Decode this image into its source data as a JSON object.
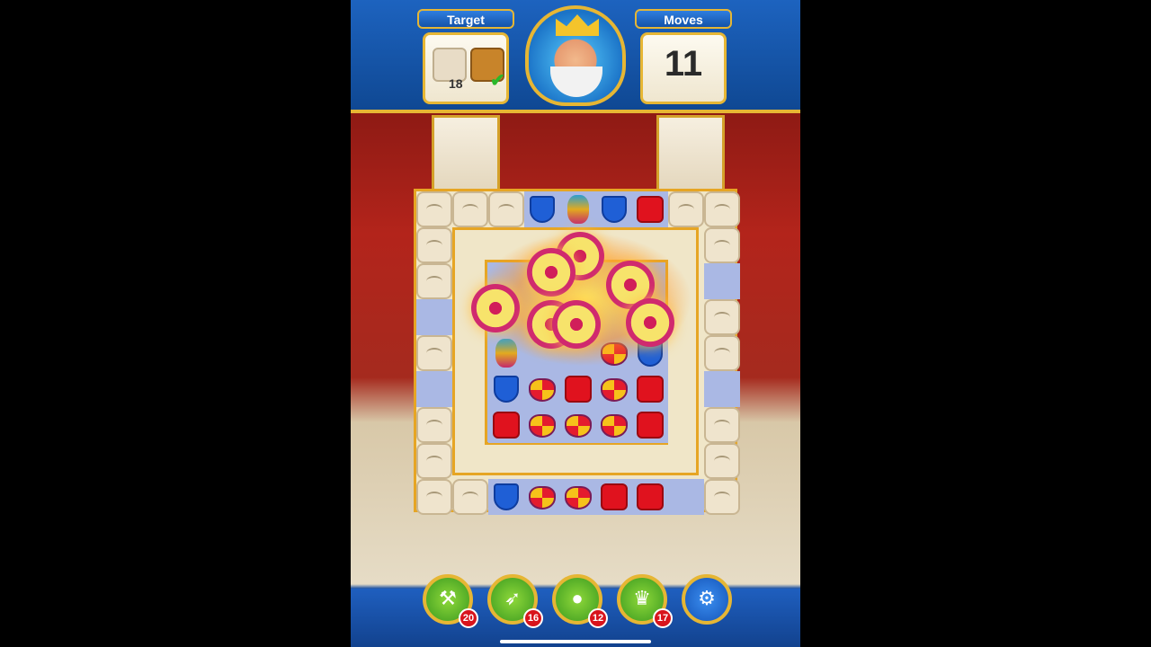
{
  "header": {
    "target_label": "Target",
    "moves_label": "Moves",
    "moves_value": "11",
    "targets": [
      {
        "icon": "sandbag-icon",
        "count": "18"
      },
      {
        "icon": "crate-icon",
        "completed": true
      }
    ]
  },
  "toolbar": {
    "boosters": [
      {
        "name": "hammer",
        "icon": "hammer-icon",
        "count": "20"
      },
      {
        "name": "arrow",
        "icon": "bow-arrow-icon",
        "count": "16"
      },
      {
        "name": "cannon",
        "icon": "cannon-icon",
        "count": "12"
      },
      {
        "name": "jester",
        "icon": "jester-hat-icon",
        "count": "17"
      }
    ],
    "settings_icon": "gear-icon"
  },
  "colors": {
    "accent": "#e6b634",
    "header_blue": "#1a5bb0",
    "wall_red": "#b3241b"
  }
}
